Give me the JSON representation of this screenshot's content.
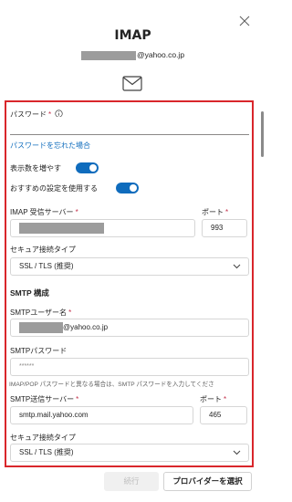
{
  "dialog": {
    "title": "IMAP",
    "account_suffix": "@yahoo.co.jp"
  },
  "form": {
    "password_label": "パスワード",
    "required_mark": "*",
    "forgot_password_link": "パスワードを忘れた場合",
    "show_more_label": "表示数を増やす",
    "show_more_on": true,
    "use_recommended_label": "おすすめの設定を使用する",
    "use_recommended_on": true,
    "imap_server_label": "IMAP 受信サーバー",
    "imap_port_label": "ポート",
    "imap_port_value": "993",
    "imap_security_label": "セキュア接続タイプ",
    "imap_security_value": "SSL / TLS (推奨)",
    "smtp_section_title": "SMTP 構成",
    "smtp_username_label": "SMTPユーザー名",
    "smtp_username_suffix": "@yahoo.co.jp",
    "smtp_password_label": "SMTPパスワード",
    "smtp_password_value": "******",
    "smtp_password_hint": "IMAP/POP パスワードと異なる場合は、SMTP パスワードを入力してくださ",
    "smtp_server_label": "SMTP送信サーバー",
    "smtp_server_value": "smtp.mail.yahoo.com",
    "smtp_port_label": "ポート",
    "smtp_port_value": "465",
    "smtp_security_label": "セキュア接続タイプ",
    "smtp_security_value": "SSL / TLS (推奨)"
  },
  "buttons": {
    "next_label": "続行",
    "choose_provider_label": "プロバイダーを選択"
  },
  "colors": {
    "accent": "#0f6cbd",
    "highlight_border": "#d9262b",
    "required": "#c4314b"
  },
  "icons": [
    "close-icon",
    "mail-icon",
    "info-icon",
    "chevron-down-icon"
  ]
}
